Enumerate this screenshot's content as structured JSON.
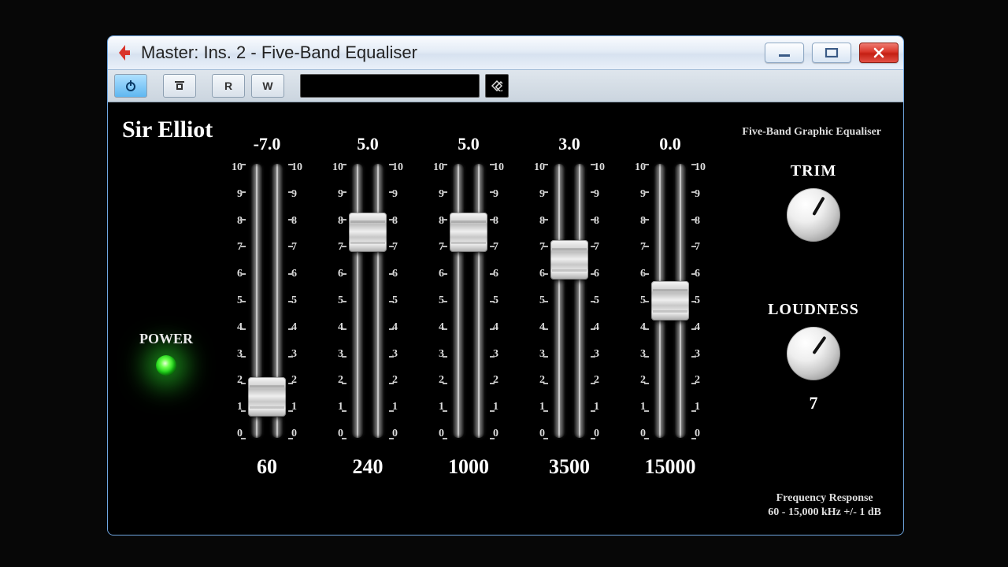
{
  "window": {
    "title": "Master: Ins. 2 - Five-Band Equaliser"
  },
  "toolbar": {
    "power": "⏻",
    "bypass": "⎍",
    "read": "R",
    "write": "W",
    "preset": ""
  },
  "plugin": {
    "brand": "Sir Elliot",
    "subtitle": "Five-Band Graphic Equaliser",
    "power_label": "POWER",
    "power_on": true,
    "scale": {
      "max": 10,
      "min": 0
    },
    "bands": [
      {
        "gain": "-7.0",
        "freq": "60",
        "value": -7.0
      },
      {
        "gain": "5.0",
        "freq": "240",
        "value": 5.0
      },
      {
        "gain": "5.0",
        "freq": "1000",
        "value": 5.0
      },
      {
        "gain": "3.0",
        "freq": "3500",
        "value": 3.0
      },
      {
        "gain": "0.0",
        "freq": "15000",
        "value": 0.0
      }
    ],
    "trim": {
      "label": "TRIM",
      "angle": 30
    },
    "loudness": {
      "label": "LOUDNESS",
      "angle": 35,
      "value": "7"
    },
    "footer_line1": "Frequency Response",
    "footer_line2": "60 - 15,000 kHz  +/- 1 dB"
  }
}
